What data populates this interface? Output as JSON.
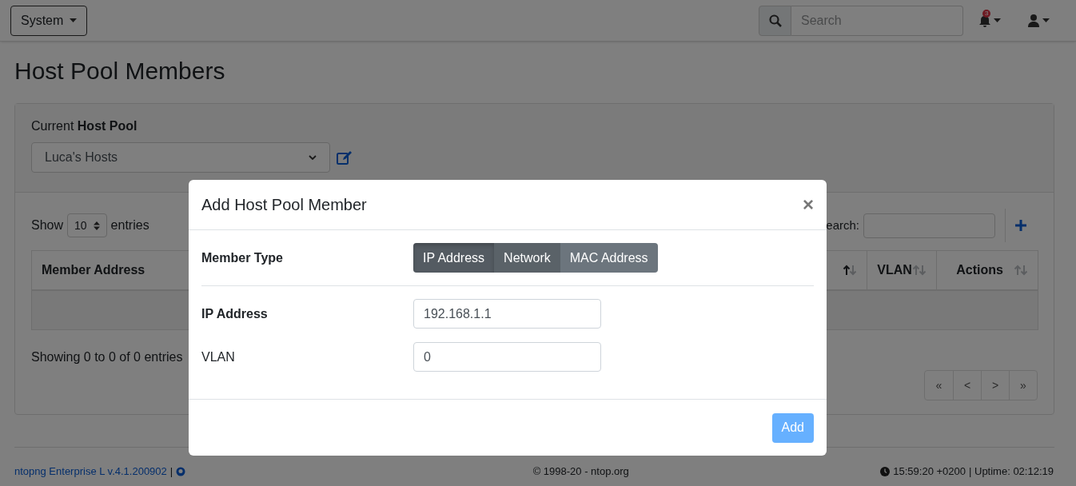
{
  "navbar": {
    "menu": "System",
    "search": {
      "placeholder": "Search"
    },
    "notifications": {
      "count": "3"
    }
  },
  "page_title": "Host Pool Members",
  "pool": {
    "label": "Current **Host Pool**",
    "selected": "Luca's Hosts"
  },
  "table_controls": {
    "show": "Show",
    "page_size": "10",
    "entries": "entries",
    "search_label": "earch:"
  },
  "table": {
    "columns": [
      {
        "label": "Member Address"
      },
      {
        "sorted": true
      },
      {
        "label": "VLAN",
        "sorted": false
      },
      {
        "label": "Actions",
        "sorted": false
      }
    ]
  },
  "info": "Showing 0 to 0 of 0 entries",
  "pagination": [
    "«",
    "<",
    ">",
    "»"
  ],
  "footer": {
    "version": "ntopng Enterprise L v.4.1.200902",
    "separator": "|",
    "copyright": "© 1998-20 - ntop.org",
    "time": "15:59:20 +0200",
    "uptime": "| Uptime: 02:12:19"
  },
  "modal": {
    "title": "Add Host Pool Member",
    "close": "×",
    "member_type_label": "Member Type",
    "types": [
      {
        "label": "IP Address",
        "selected": true,
        "hovered": false
      },
      {
        "label": "Network",
        "selected": false,
        "hovered": true
      },
      {
        "label": "MAC Address",
        "selected": false,
        "hovered": false
      }
    ],
    "fields": [
      {
        "label": "IP Address",
        "bold": true,
        "value": "192.168.1.1"
      },
      {
        "label": "VLAN",
        "bold": false,
        "value": "0"
      }
    ],
    "submit": {
      "label": "Add",
      "disabled": true
    }
  }
}
